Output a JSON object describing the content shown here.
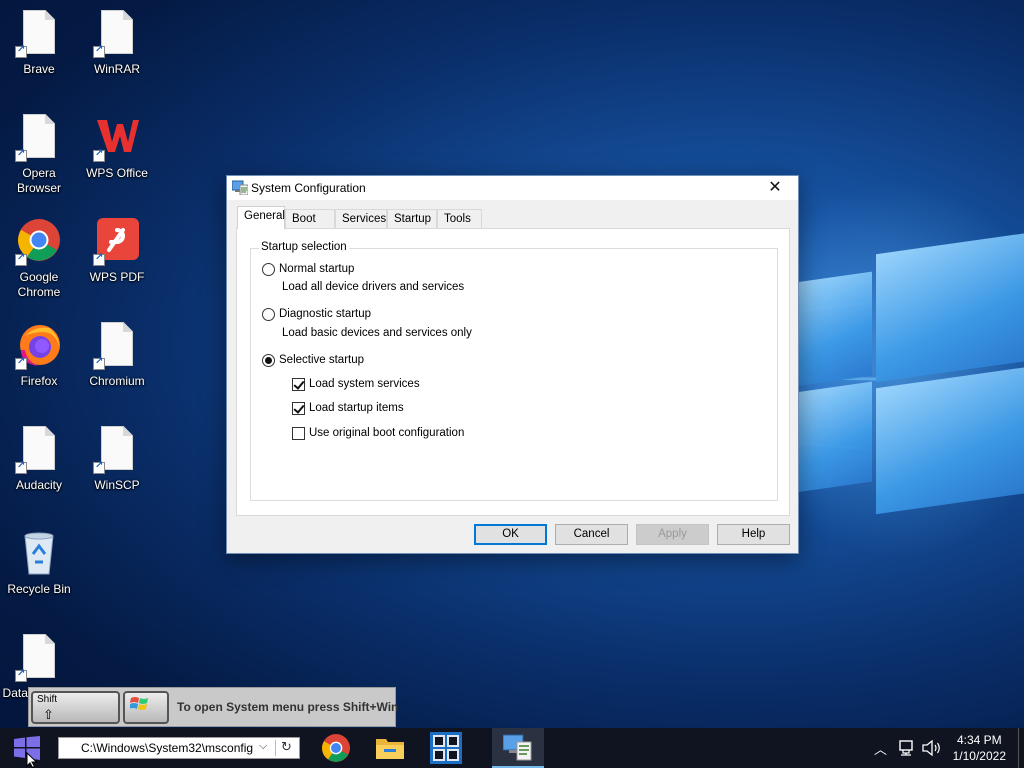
{
  "desktop": {
    "icons": [
      {
        "label": "Brave",
        "kind": "doc"
      },
      {
        "label": "WinRAR",
        "kind": "doc"
      },
      {
        "label": "Opera Browser",
        "kind": "doc"
      },
      {
        "label": "WPS Office",
        "kind": "wps"
      },
      {
        "label": "Google Chrome",
        "kind": "chrome"
      },
      {
        "label": "WPS PDF",
        "kind": "wpspdf"
      },
      {
        "label": "Firefox",
        "kind": "firefox"
      },
      {
        "label": "Chromium",
        "kind": "doc"
      },
      {
        "label": "Audacity",
        "kind": "doc"
      },
      {
        "label": "WinSCP",
        "kind": "doc"
      },
      {
        "label": "Recycle Bin",
        "kind": "recycle"
      },
      {
        "label": "DataWagon...",
        "kind": "doc"
      }
    ]
  },
  "dialog": {
    "title": "System Configuration",
    "close_glyph": "✕",
    "tabs": [
      "General",
      "Boot",
      "Services",
      "Startup",
      "Tools"
    ],
    "active_tab": "General",
    "group_title": "Startup selection",
    "options": [
      {
        "label": "Normal startup",
        "desc": "Load all device drivers and services",
        "selected": false
      },
      {
        "label": "Diagnostic startup",
        "desc": "Load basic devices and services only",
        "selected": false
      },
      {
        "label": "Selective startup",
        "selected": true
      }
    ],
    "checks": [
      {
        "label": "Load system services",
        "checked": true
      },
      {
        "label": "Load startup items",
        "checked": true
      },
      {
        "label": "Use original boot configuration",
        "checked": false
      }
    ],
    "buttons": {
      "ok": "OK",
      "cancel": "Cancel",
      "apply": "Apply",
      "help": "Help"
    }
  },
  "hint": {
    "shift_key": "Shift",
    "shift_arrow": "⇧",
    "text": "To open System menu press Shift+Win"
  },
  "taskbar": {
    "run_value": "C:\\Windows\\System32\\msconfig",
    "dropdown_glyph": "⌵",
    "refresh_glyph": "↻",
    "apps": [
      "chrome-icon",
      "file-explorer-icon",
      "app-grid-icon",
      "system-configuration-icon"
    ],
    "tray_chevron": "︿",
    "time": "4:34 PM",
    "date": "1/10/2022"
  },
  "colors": {
    "accent": "#0078d7",
    "taskbar": "#0f1420",
    "wallpaper_light": "#2f7fd8",
    "wallpaper_dark": "#041a44"
  }
}
